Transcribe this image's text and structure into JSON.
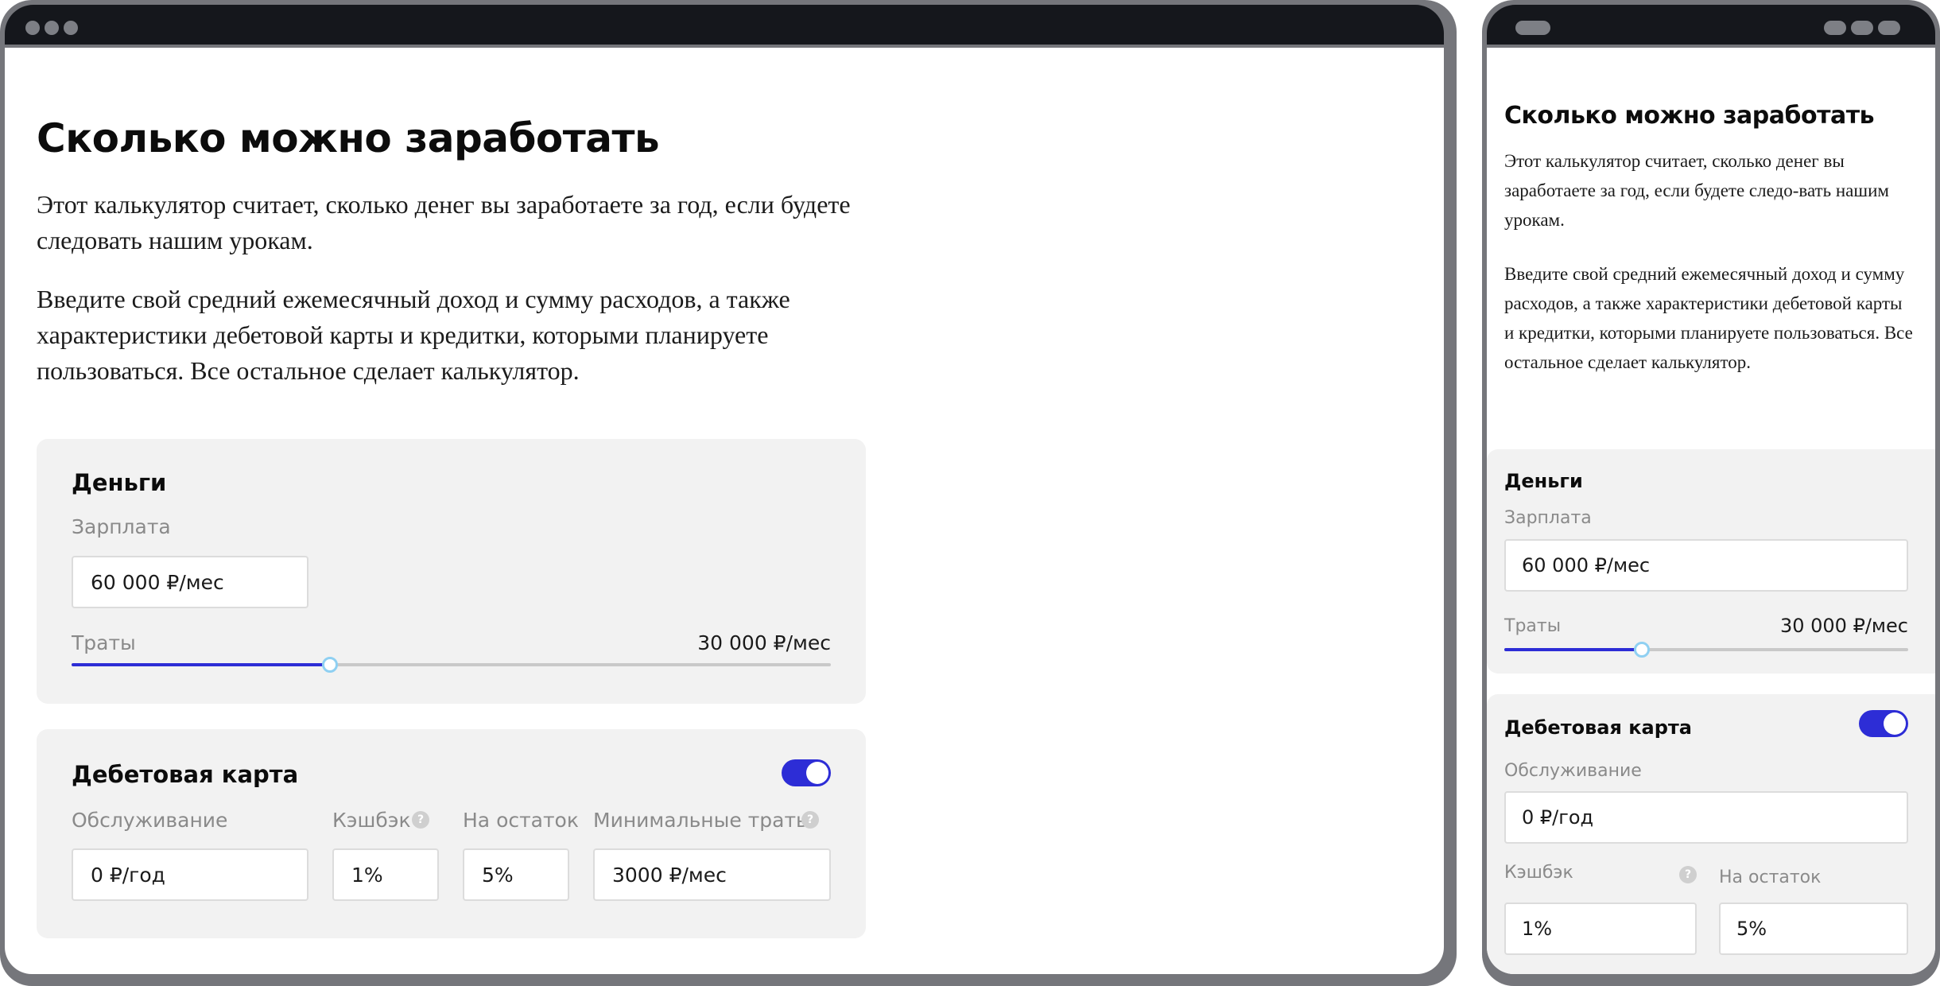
{
  "calculator": {
    "title": "Сколько можно заработать",
    "intro": "Этот калькулятор считает, сколько денег вы заработаете за год, если будете следовать нашим урокам.",
    "intro_mobile": "Этот калькулятор считает, сколько денег вы заработаете за год, если будете следо-вать нашим урокам.",
    "instructions": "Введите свой средний ежемесячный доход и сумму расходов, а также характеристики дебетовой карты и кредитки, которыми планируете пользоваться. Все остальное сделает калькулятор.",
    "money": {
      "title": "Деньги",
      "salary_label": "Зарплата",
      "salary_value": "60 000 ₽/мес",
      "expenses_label": "Траты",
      "expenses_value": "30 000 ₽/мес",
      "expenses_slider_fraction": 0.34
    },
    "debit_card": {
      "title": "Дебетовая карта",
      "enabled": true,
      "service_label": "Обслуживание",
      "service_value": "0 ₽/год",
      "cashback_label": "Кэшбэк",
      "cashback_value": "1%",
      "balance_label": "На остаток",
      "balance_value": "5%",
      "min_spend_label": "Минимальные траты",
      "min_spend_value": "3000 ₽/мес",
      "help_symbol": "?"
    }
  },
  "colors": {
    "accent": "#2d2dd6",
    "card_background": "#f2f2f2",
    "label": "#8a8a8a",
    "frame": "#75767b",
    "titlebar": "#15171c",
    "slider_thumb_border": "#8fd0f2"
  }
}
